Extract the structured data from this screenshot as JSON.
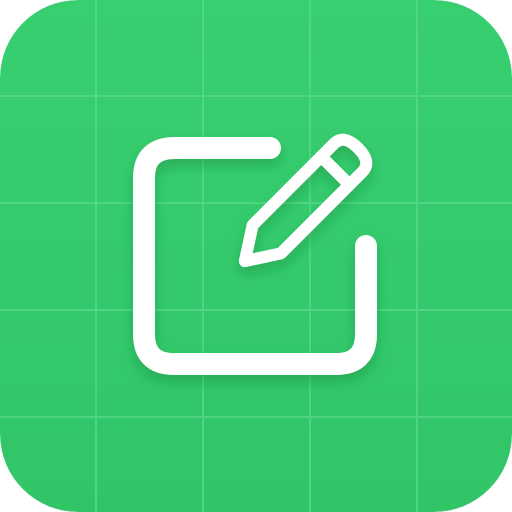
{
  "icon": {
    "name": "note-edit-app-icon",
    "glyph": "pencil-on-square-icon",
    "colors": {
      "background": "#35cc6d",
      "background_dark": "#2fc265",
      "grid": "#58d88a",
      "glyph": "#ffffff",
      "shadow": "#1f9a4b"
    }
  }
}
